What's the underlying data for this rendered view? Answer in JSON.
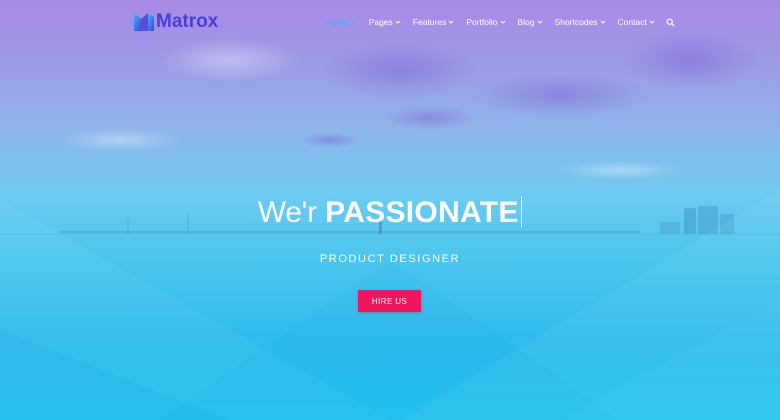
{
  "brand": {
    "name": "Matrox",
    "logo_icon": "logo-m-icon",
    "color": "#4a3fd8"
  },
  "nav": {
    "items": [
      {
        "label": "Home",
        "active": true
      },
      {
        "label": "Pages",
        "active": false
      },
      {
        "label": "Features",
        "active": false
      },
      {
        "label": "Portfolio",
        "active": false
      },
      {
        "label": "Blog",
        "active": false
      },
      {
        "label": "Shortcodes",
        "active": false
      },
      {
        "label": "Contact",
        "active": false
      }
    ],
    "active_color": "#3fb0ff",
    "dropdown_icon": "chevron-down-icon",
    "search_icon": "search-icon"
  },
  "hero": {
    "headline_light": "We'r",
    "headline_bold": "PASSIONATE",
    "subtitle": "PRODUCT DESIGNER",
    "cta_label": "HIRE US",
    "cta_color": "#f0155e"
  }
}
